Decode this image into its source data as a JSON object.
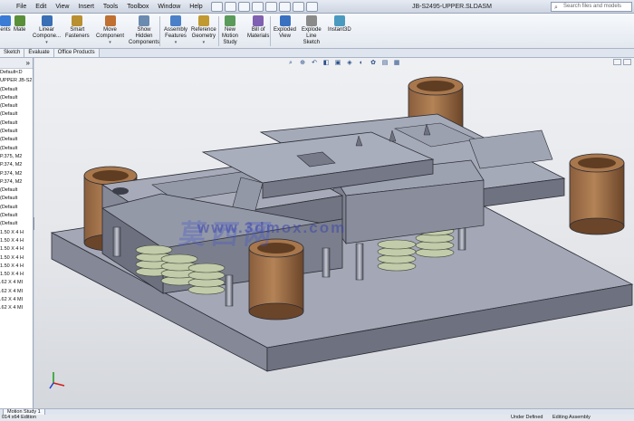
{
  "menus": [
    "File",
    "Edit",
    "View",
    "Insert",
    "Tools",
    "Toolbox",
    "Window",
    "Help"
  ],
  "document_title": "JB-S2495-UPPER.SLDASM",
  "search": {
    "placeholder": "Search files and models"
  },
  "command_buttons": [
    {
      "label": "ents",
      "icon": "insert-components-icon"
    },
    {
      "label": "Mate",
      "icon": "mate-icon"
    },
    {
      "label": "Linear\nCompone...",
      "icon": "linear-pattern-icon",
      "dropdown": true
    },
    {
      "label": "Smart\nFasteners",
      "icon": "smart-fasteners-icon"
    },
    {
      "label": "Move\nComponent",
      "icon": "move-component-icon",
      "dropdown": true
    },
    {
      "label": "Show\nHidden\nComponents",
      "icon": "show-hidden-icon"
    },
    {
      "label": "Assembly\nFeatures",
      "icon": "assembly-features-icon",
      "dropdown": true
    },
    {
      "label": "Reference\nGeometry",
      "icon": "reference-geometry-icon",
      "dropdown": true
    },
    {
      "label": "New\nMotion\nStudy",
      "icon": "motion-study-icon"
    },
    {
      "label": "Bill of\nMaterials",
      "icon": "bom-icon"
    },
    {
      "label": "Exploded\nView",
      "icon": "exploded-view-icon"
    },
    {
      "label": "Explode\nLine\nSketch",
      "icon": "explode-line-icon"
    },
    {
      "label": "Instant3D",
      "icon": "instant3d-icon"
    }
  ],
  "tabs": [
    "Sketch",
    "Evaluate",
    "Office Products"
  ],
  "tree": {
    "collapse_glyph": "»",
    "items": [
      "Default<D",
      "UPPER JB-S2",
      "(Default",
      "(Default",
      "(Default",
      "(Default",
      "(Default",
      "(Default",
      "(Default",
      "(Default",
      "P.375, M2",
      "P.374, M2",
      "P.374, M2",
      "P.374, M2",
      "(Default",
      "(Default",
      "(Default",
      "(Default",
      "(Default",
      "1.50 X 4 H",
      "1.50 X 4 H",
      "1.50 X 4 H",
      "1.50 X 4 H",
      "1.50 X 4 H",
      "1.50 X 4 H",
      ".62 X 4 MI",
      ".62 X 4 MI",
      ".62 X 4 MI",
      ".62 X 4 MI"
    ]
  },
  "watermark": {
    "cn": "莫西网",
    "url": "www.3dmox.com"
  },
  "bottom_tab": "Motion Study 1",
  "status": {
    "left": "014 x64 Edition",
    "mid": "Under Defined",
    "right": "Editing Assembly"
  },
  "colors": {
    "bronze": "#7a5236",
    "plate_top": "#a7abb9",
    "plate_side": "#7f8291",
    "spring": "#c3ccaa"
  }
}
